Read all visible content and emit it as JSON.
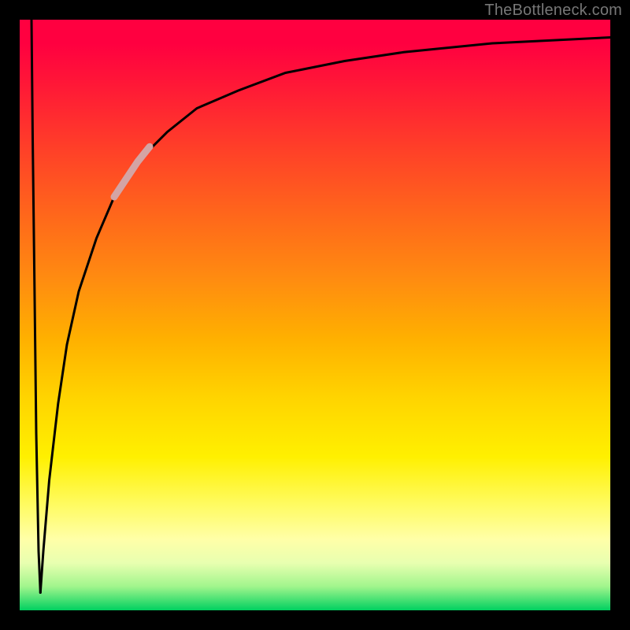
{
  "watermark": "TheBottleneck.com",
  "chart_data": {
    "type": "line",
    "title": "",
    "xlabel": "",
    "ylabel": "",
    "xlim": [
      0,
      100
    ],
    "ylim": [
      0,
      100
    ],
    "grid": false,
    "legend": false,
    "notes": "Axis values are estimated from pixel positions; the chart has no visible tick labels. y-scale: 0 = bottom (green/optimal), 100 = top (red/bottleneck). The two black curves form a V near x≈3 and an asymptotic rise toward y≈97. A short pink highlight segment overlays the rising curve roughly between x≈16 and x≈22.",
    "series": [
      {
        "name": "left-branch",
        "color": "#000000",
        "x": [
          2.0,
          2.2,
          2.5,
          2.8,
          3.2,
          3.5
        ],
        "y": [
          100,
          80,
          55,
          30,
          10,
          3
        ]
      },
      {
        "name": "right-branch",
        "color": "#000000",
        "x": [
          3.5,
          4.0,
          5.0,
          6.5,
          8.0,
          10.0,
          13.0,
          16.0,
          20.0,
          25.0,
          30.0,
          37.0,
          45.0,
          55.0,
          65.0,
          80.0,
          100.0
        ],
        "y": [
          3,
          10,
          22,
          35,
          45,
          54,
          63,
          70,
          76,
          81,
          85,
          88,
          91,
          93,
          94.5,
          96,
          97
        ]
      },
      {
        "name": "highlight-segment",
        "color": "#d4a4a4",
        "x": [
          16.0,
          18.0,
          20.0,
          22.0
        ],
        "y": [
          70,
          73,
          76,
          78.5
        ]
      }
    ],
    "gradient_stops": [
      {
        "pos": 0.0,
        "color": "#ff0040"
      },
      {
        "pos": 0.04,
        "color": "#ff0040"
      },
      {
        "pos": 0.1,
        "color": "#ff1438"
      },
      {
        "pos": 0.22,
        "color": "#ff4028"
      },
      {
        "pos": 0.34,
        "color": "#ff6a1a"
      },
      {
        "pos": 0.44,
        "color": "#ff8c10"
      },
      {
        "pos": 0.54,
        "color": "#ffb000"
      },
      {
        "pos": 0.64,
        "color": "#ffd400"
      },
      {
        "pos": 0.74,
        "color": "#fff000"
      },
      {
        "pos": 0.82,
        "color": "#fffb60"
      },
      {
        "pos": 0.88,
        "color": "#ffffa8"
      },
      {
        "pos": 0.92,
        "color": "#e8ffb0"
      },
      {
        "pos": 0.96,
        "color": "#a0f58c"
      },
      {
        "pos": 1.0,
        "color": "#00d060"
      }
    ]
  }
}
